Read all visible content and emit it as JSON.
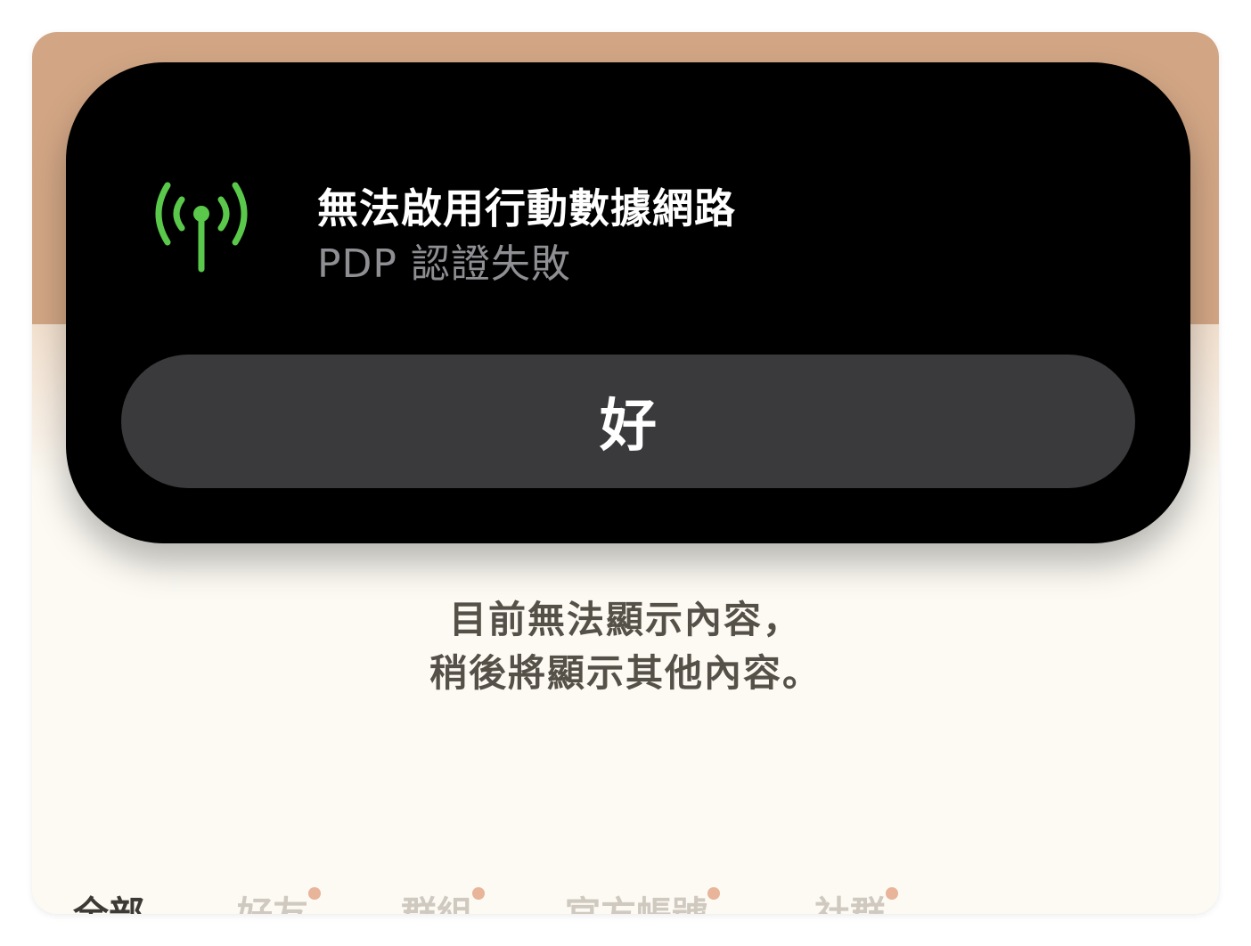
{
  "alert": {
    "title": "無法啟用行動數據網路",
    "subtitle": "PDP 認證失敗",
    "ok_label": "好",
    "icon": "cellular-antenna-icon",
    "icon_color": "#5ac84a"
  },
  "content": {
    "empty_line1": "目前無法顯示內容，",
    "empty_line2": "稍後將顯示其他內容。"
  },
  "tabs": [
    {
      "label": "全部",
      "active": true,
      "dot": false
    },
    {
      "label": "好友",
      "active": false,
      "dot": true
    },
    {
      "label": "群組",
      "active": false,
      "dot": true
    },
    {
      "label": "官方帳號",
      "active": false,
      "dot": true
    },
    {
      "label": "社群",
      "active": false,
      "dot": true
    }
  ]
}
